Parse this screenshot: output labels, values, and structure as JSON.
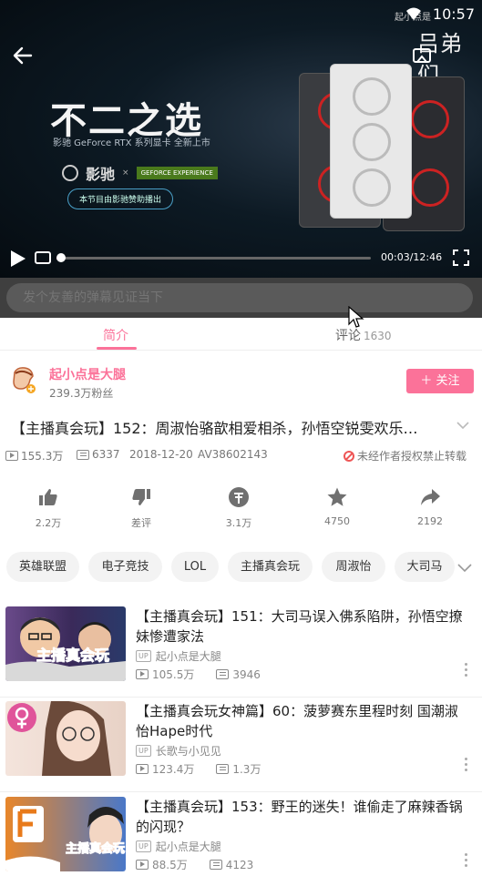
{
  "status_bar": {
    "time": "10:57",
    "uploader_small": "起小点是"
  },
  "player": {
    "overlay_title": "吕弟们",
    "ad": {
      "headline": "不二之选",
      "subline": "影驰 GeForce RTX 系列显卡 全新上市",
      "brand": "影驰",
      "partner": "GEFORCE EXPERIENCE",
      "sponsor": "本节目由影驰赞助播出"
    },
    "timecode": "00:03/12:46",
    "progress_fraction": 0.004
  },
  "danmaku": {
    "placeholder": "发个友善的弹幕见证当下"
  },
  "tabs": {
    "intro": "简介",
    "comments": "评论",
    "comments_count": "1630"
  },
  "uploader": {
    "name": "起小点是大腿",
    "fans": "239.3万粉丝",
    "follow_label": "＋ 关注"
  },
  "video": {
    "title": "【主播真会玩】152：周淑怡骆歆相爱相杀，孙悟空锐雯欢乐…",
    "views": "155.3万",
    "danmaku_count": "6337",
    "date": "2018-12-20",
    "av": "AV38602143",
    "repost_notice": "未经作者授权禁止转载"
  },
  "actions": [
    {
      "icon": "thumbs-up-icon",
      "label": "2.2万"
    },
    {
      "icon": "thumbs-down-icon",
      "label": "差评"
    },
    {
      "icon": "coin-icon",
      "label": "3.1万"
    },
    {
      "icon": "star-icon",
      "label": "4750"
    },
    {
      "icon": "share-icon",
      "label": "2192"
    }
  ],
  "tags": [
    "英雄联盟",
    "电子竞技",
    "LOL",
    "主播真会玩",
    "周淑怡",
    "大司马"
  ],
  "related": [
    {
      "title": "【主播真会玩】151：大司马误入佛系陷阱，孙悟空撩妹惨遭家法",
      "up": "起小点是大腿",
      "views": "105.5万",
      "danmaku": "3946",
      "thumb_text": "主播真会玩"
    },
    {
      "title": "【主播真会玩女神篇】60：菠萝赛东里程时刻 国潮淑怡Hape时代",
      "up": "长歌与小见见",
      "views": "123.4万",
      "danmaku": "1.3万",
      "thumb_text": ""
    },
    {
      "title": "【主播真会玩】153：野王的迷失！谁偷走了麻辣香锅的闪现？",
      "up": "起小点是大腿",
      "views": "88.5万",
      "danmaku": "4123",
      "thumb_text": "主播真会玩"
    }
  ],
  "labels": {
    "up_badge": "UP"
  },
  "colors": {
    "accent": "#fb7299",
    "player_bg": "#07121b",
    "danmaku_bar": "#3f3f3f"
  }
}
